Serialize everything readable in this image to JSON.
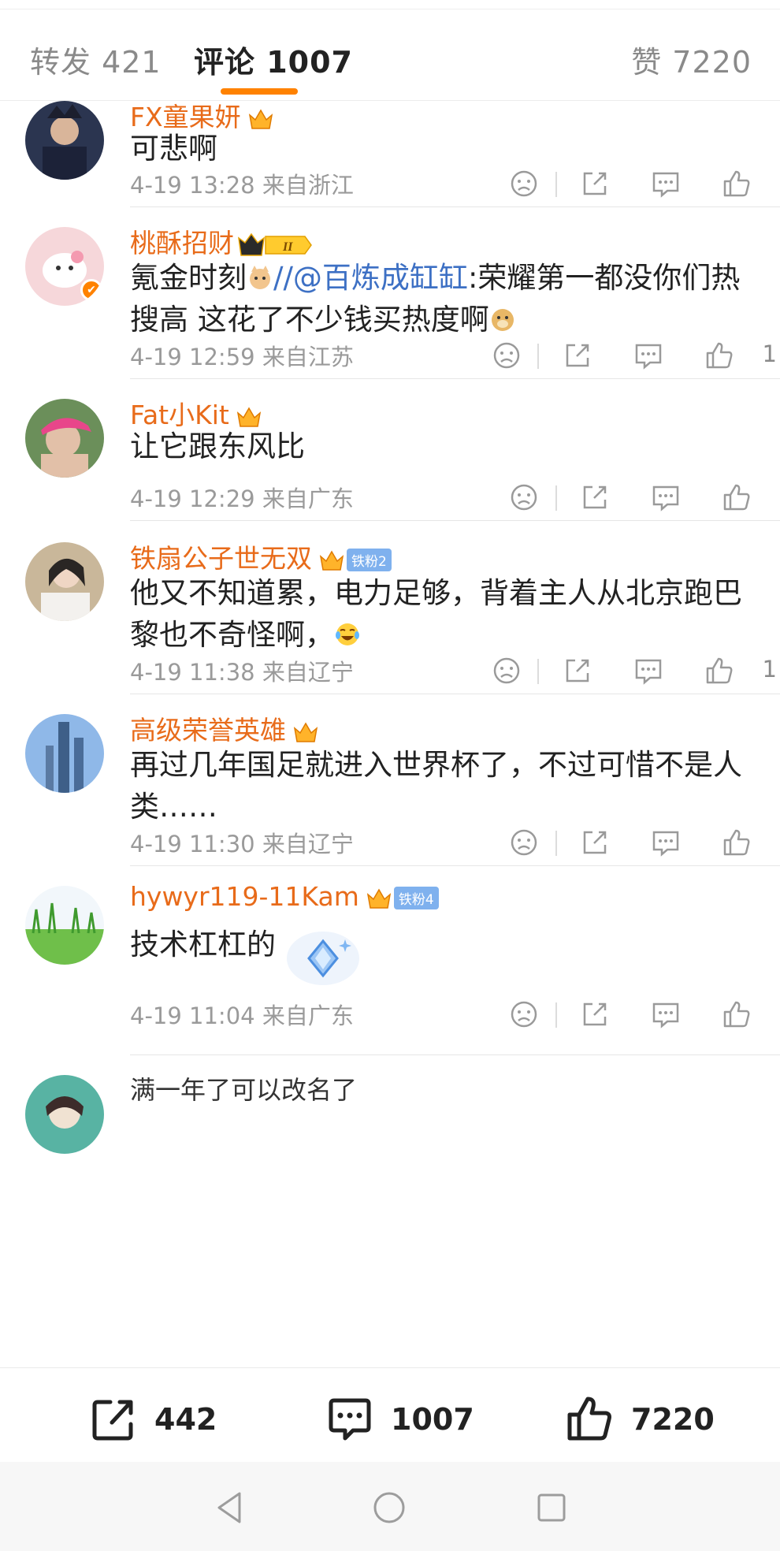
{
  "tabs": {
    "repost": "转发 421",
    "comments": "评论 1007",
    "likes": "赞 7220"
  },
  "comments": [
    {
      "user": "FX童果妍",
      "text": "可悲啊",
      "time": "4-19 13:28",
      "location": "来自浙江",
      "likes": ""
    },
    {
      "user": "桃酥招财",
      "text_before": "氪金时刻",
      "mention": "//@百炼成缸缸",
      "text_after": ":荣耀第一都没你们热搜高 这花了不少钱买热度啊",
      "time": "4-19 12:59",
      "location": "来自江苏",
      "likes": "1"
    },
    {
      "user": "Fat小Kit",
      "text": "让它跟东风比",
      "time": "4-19 12:29",
      "location": "来自广东",
      "likes": ""
    },
    {
      "user": "铁扇公子世无双",
      "fan_badge": "铁粉2",
      "text": "他又不知道累，电力足够，背着主人从北京跑巴黎也不奇怪啊，",
      "time": "4-19 11:38",
      "location": "来自辽宁",
      "likes": "1"
    },
    {
      "user": "高级荣誉英雄",
      "text": "再过几年国足就进入世界杯了，不过可惜不是人类……",
      "time": "4-19 11:30",
      "location": "来自辽宁",
      "likes": ""
    },
    {
      "user": "hywyr119-11Kam",
      "fan_badge": "铁粉4",
      "text": "技术杠杠的",
      "time": "4-19 11:04",
      "location": "来自广东",
      "likes": ""
    },
    {
      "user": "满一年了可以改名了"
    }
  ],
  "bottom_bar": {
    "repost_count": "442",
    "comment_count": "1007",
    "like_count": "7220"
  },
  "colors": {
    "accent": "#ff8200",
    "username": "#e86b1a",
    "mention": "#3d70c4",
    "meta": "#9a9a9a"
  }
}
